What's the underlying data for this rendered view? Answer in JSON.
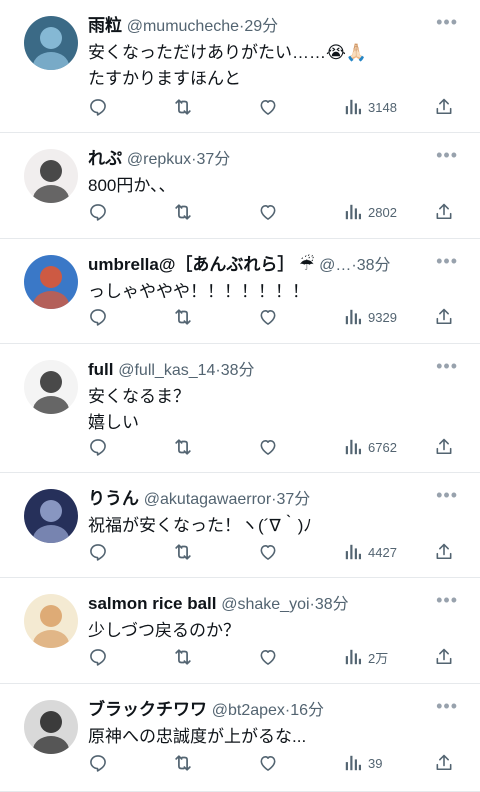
{
  "posts": [
    {
      "name": "雨粒",
      "handle": "@mumucheche",
      "time": "29分",
      "lines": [
        "安くなっただけありがたい……😭🙏🏻",
        "たすかりますほんと"
      ],
      "views": "3148",
      "avatar_colors": [
        "#3b6a86",
        "#93c6e2"
      ]
    },
    {
      "name": "れぷ",
      "handle": "@repkux",
      "time": "37分",
      "lines": [
        "800円か、、"
      ],
      "views": "2802",
      "avatar_colors": [
        "#f1eeee",
        "#2b2b2b"
      ]
    },
    {
      "name": "umbrella@［あんぶれら］",
      "badge": "☔",
      "handle": "@…",
      "time": "38分",
      "lines": [
        "っしゃややや！！！！！！！"
      ],
      "views": "9329",
      "avatar_colors": [
        "#3a78c7",
        "#e8552c"
      ]
    },
    {
      "name": "full",
      "handle": "@full_kas_14",
      "time": "38分",
      "lines": [
        "安くなるま？",
        "嬉しい"
      ],
      "views": "6762",
      "avatar_colors": [
        "#f4f4f4",
        "#2a2a2a"
      ]
    },
    {
      "name": "りうん",
      "handle": "@akutagawaerror",
      "time": "37分",
      "lines": [
        "祝福が安くなった！ヽ(´∇｀)ﾉ"
      ],
      "views": "4427",
      "avatar_colors": [
        "#26305a",
        "#9aa8d4"
      ]
    },
    {
      "name": "salmon rice ball",
      "handle": "@shake_yoi",
      "time": "38分",
      "lines": [
        "少しづつ戻るのか？"
      ],
      "views": "2万",
      "avatar_colors": [
        "#f4ead2",
        "#d9a066"
      ]
    },
    {
      "name": "ブラックチワワ",
      "handle": "@bt2apex",
      "time": "16分",
      "lines": [
        "原神への忠誠度が上がるな..."
      ],
      "views": "39",
      "avatar_colors": [
        "#d9d9d9",
        "#1e1e1e"
      ]
    }
  ],
  "icons": {
    "reply": "reply-icon",
    "repost": "repost-icon",
    "like": "like-icon",
    "views": "views-icon",
    "share": "share-icon",
    "more": "more-icon"
  },
  "colors": {
    "text": "#0f1419",
    "secondary": "#536471",
    "divider": "#e6e9ec"
  }
}
